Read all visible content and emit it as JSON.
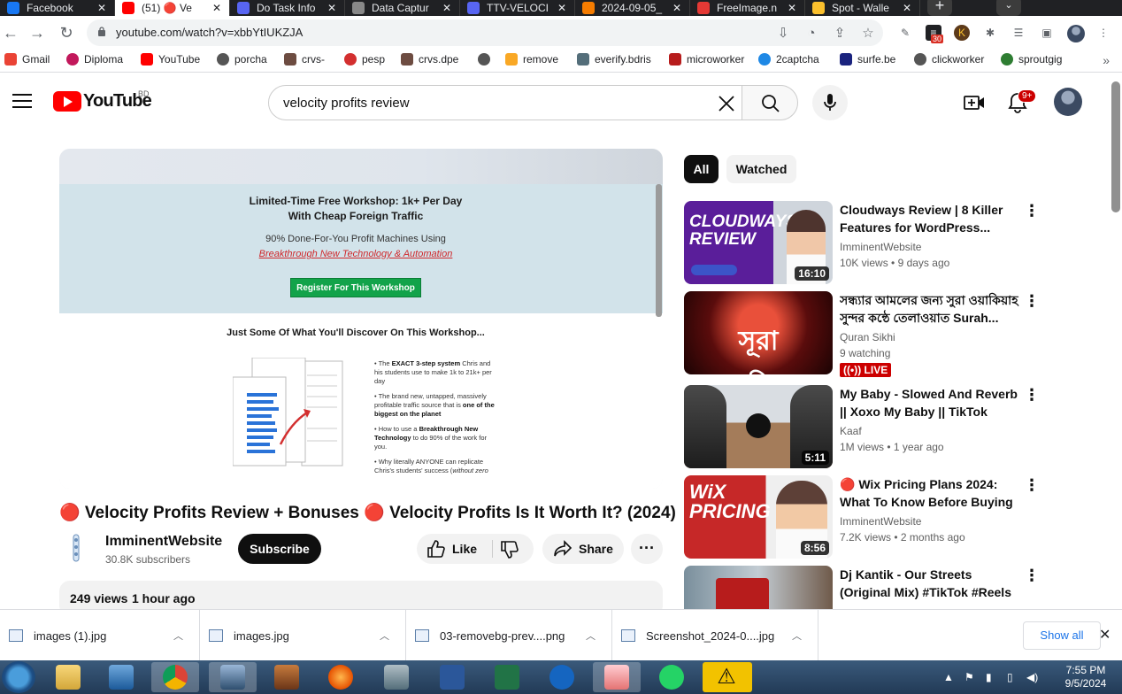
{
  "tabs": [
    {
      "title": "Facebook",
      "color": "#1877f2"
    },
    {
      "title": "(51) 🔴 Ve",
      "color": "#ff0000"
    },
    {
      "title": "Do Task Info",
      "color": "#5865f2"
    },
    {
      "title": "Data Captur",
      "color": "#888888"
    },
    {
      "title": "TTV-VELOCI",
      "color": "#5865f2"
    },
    {
      "title": "2024-09-05_",
      "color": "#f57c00"
    },
    {
      "title": "FreeImage.n",
      "color": "#e53935"
    },
    {
      "title": "Spot - Walle",
      "color": "#fbc02d"
    }
  ],
  "tab_close_icon": "✕",
  "browser": {
    "url": "youtube.com/watch?v=xbbYtIUKZJA",
    "ext_badge": "30"
  },
  "bookmarks": [
    {
      "label": "Gmail",
      "color": "#ea4335"
    },
    {
      "label": "Diploma",
      "color": "#c2185b"
    },
    {
      "label": "YouTube",
      "color": "#ff0000"
    },
    {
      "label": "porcha",
      "color": "#555555"
    },
    {
      "label": "crvs-",
      "color": "#6d4c41"
    },
    {
      "label": "pesp",
      "color": "#d32f2f"
    },
    {
      "label": "crvs.dpe",
      "color": "#6d4c41"
    },
    {
      "label": "",
      "color": "#555555"
    },
    {
      "label": "remove",
      "color": "#f9a825"
    },
    {
      "label": "everify.bdris",
      "color": "#546e7a"
    },
    {
      "label": "microworker",
      "color": "#b71c1c"
    },
    {
      "label": "2captcha",
      "color": "#1e88e5"
    },
    {
      "label": "surfe.be",
      "color": "#1a237e"
    },
    {
      "label": "clickworker",
      "color": "#555555"
    },
    {
      "label": "sproutgig",
      "color": "#2e7d32"
    }
  ],
  "youtube": {
    "logo_text": "YouTube",
    "country_code": "BD",
    "search_query": "velocity profits review",
    "notification_count": "9+"
  },
  "video": {
    "title": "🔴 Velocity Profits Review + Bonuses 🔴 Velocity Profits Is It Worth It? (2024)",
    "channel": "ImminentWebsite",
    "subscribers": "30.8K subscribers",
    "subscribe_label": "Subscribe",
    "like_label": "Like",
    "share_label": "Share",
    "views": "249 views",
    "uploaded": "1 hour ago"
  },
  "player_frame": {
    "headline_1": "Limited-Time Free Workshop: 1k+ Per Day",
    "headline_2": "With Cheap Foreign Traffic",
    "subline": "90% Done-For-You Profit Machines Using",
    "link": "Breakthrough New Technology & Automation",
    "cta": "Register For This Workshop",
    "discover": "Just Some Of What You'll Discover On This Workshop...",
    "bullets": [
      {
        "pre": "• The ",
        "bold": "EXACT 3-step system",
        "post": " Chris and his students use to make 1k to 21k+ per day"
      },
      {
        "pre": "• The brand new, untapped, massively profitable traffic source that is ",
        "bold": "one of the biggest on the planet",
        "post": ""
      },
      {
        "pre": "• How to use a ",
        "bold": "Breakthrough New Technology",
        "post": " to do 90% of the work for you."
      },
      {
        "pre": "• Why literally ANYONE can replicate Chris's students' success (",
        "bold": "",
        "post": "without zero"
      }
    ]
  },
  "sidebar": {
    "chips": [
      "All",
      "Watched"
    ],
    "recommendations": [
      {
        "title": "Cloudways Review | 8 Killer Features for WordPress...",
        "channel": "ImminentWebsite",
        "views": "10K views",
        "age": "9 days ago",
        "duration": "16:10",
        "thumb_text": "CLOUDWAYS REVIEW",
        "live": ""
      },
      {
        "title": "সন্ধ্যার আমলের জন্য সুরা ওয়াকিয়াহ সুন্দর কন্ঠে তেলাওয়াত Surah...",
        "channel": "Quran Sikhi",
        "views": "9 watching",
        "age": "",
        "duration": "",
        "thumb_text": "সূরা ওয়াকিয়াহ",
        "live": "LIVE"
      },
      {
        "title": "My Baby - Slowed And Reverb || Xoxo My Baby || TikTok Remix",
        "channel": "Kaaf",
        "views": "1M views",
        "age": "1 year ago",
        "duration": "5:11",
        "thumb_text": "",
        "live": ""
      },
      {
        "title": "🔴 Wix Pricing Plans 2024: What To Know Before Buying",
        "channel": "ImminentWebsite",
        "views": "7.2K views",
        "age": "2 months ago",
        "duration": "8:56",
        "thumb_text": "WiX PRICING",
        "live": ""
      },
      {
        "title": "Dj Kantik - Our Streets (Original Mix) #TikTok #Reels Music",
        "channel": "",
        "views": "",
        "age": "",
        "duration": "",
        "thumb_text": "",
        "live": ""
      }
    ]
  },
  "downloads": {
    "items": [
      "images (1).jpg",
      "images.jpg",
      "03-removebg-prev....png",
      "Screenshot_2024-0....jpg"
    ],
    "show_all": "Show all"
  },
  "taskbar": {
    "time": "7:55 PM",
    "date": "9/5/2024"
  }
}
